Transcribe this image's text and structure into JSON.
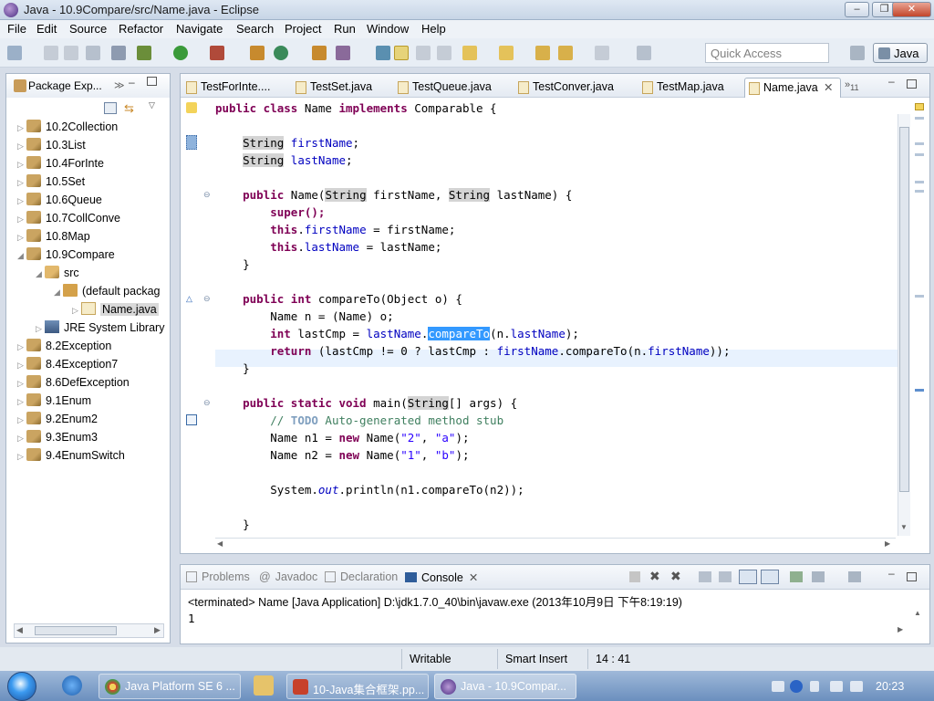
{
  "window": {
    "title": "Java - 10.9Compare/src/Name.java - Eclipse",
    "buttons": [
      "minimize",
      "maximize",
      "close"
    ]
  },
  "menu": [
    "File",
    "Edit",
    "Source",
    "Refactor",
    "Navigate",
    "Search",
    "Project",
    "Run",
    "Window",
    "Help"
  ],
  "toolbar": {
    "quick_access_placeholder": "Quick Access",
    "perspective": "Java"
  },
  "package_explorer": {
    "title": "Package Exp...",
    "tree": [
      {
        "label": "10.2Collection",
        "type": "project",
        "expanded": false
      },
      {
        "label": "10.3List",
        "type": "project",
        "expanded": false
      },
      {
        "label": "10.4ForInte",
        "type": "project",
        "expanded": false
      },
      {
        "label": "10.5Set",
        "type": "project",
        "expanded": false
      },
      {
        "label": "10.6Queue",
        "type": "project",
        "expanded": false
      },
      {
        "label": "10.7CollConve",
        "type": "project",
        "expanded": false
      },
      {
        "label": "10.8Map",
        "type": "project",
        "expanded": false
      },
      {
        "label": "10.9Compare",
        "type": "project",
        "expanded": true
      },
      {
        "label": "src",
        "type": "source-folder",
        "expanded": true
      },
      {
        "label": "(default packag",
        "type": "package",
        "expanded": true
      },
      {
        "label": "Name.java",
        "type": "java-file",
        "selected": true
      },
      {
        "label": "JRE System Library",
        "type": "library",
        "expanded": false
      },
      {
        "label": "8.2Exception",
        "type": "project",
        "expanded": false
      },
      {
        "label": "8.4Exception7",
        "type": "project",
        "expanded": false
      },
      {
        "label": "8.6DefException",
        "type": "project",
        "expanded": false
      },
      {
        "label": "9.1Enum",
        "type": "project",
        "expanded": false
      },
      {
        "label": "9.2Enum2",
        "type": "project",
        "expanded": false
      },
      {
        "label": "9.3Enum3",
        "type": "project",
        "expanded": false
      },
      {
        "label": "9.4EnumSwitch",
        "type": "project",
        "expanded": false
      }
    ]
  },
  "editor": {
    "tabs": [
      {
        "label": "TestForInte....",
        "active": false
      },
      {
        "label": "TestSet.java",
        "active": false
      },
      {
        "label": "TestQueue.java",
        "active": false
      },
      {
        "label": "TestConver.java",
        "active": false
      },
      {
        "label": "TestMap.java",
        "active": false
      },
      {
        "label": "Name.java",
        "active": true
      }
    ],
    "overflow_count": "11",
    "code": {
      "l1": "public class Name implements Comparable {",
      "l3_type": "String",
      "l3_field": "firstName",
      "l4_type": "String",
      "l4_field": "lastName",
      "l6_kw": "public",
      "l6_name": "Name(",
      "l6_t1": "String",
      "l6_p1": " firstName, ",
      "l6_t2": "String",
      "l6_p2": " lastName) {",
      "l7": "super();",
      "l8_kw": "this",
      "l8_field": "firstName",
      "l8_rest": " = firstName;",
      "l9_kw": "this",
      "l9_field": "lastName",
      "l9_rest": " = lastName;",
      "l10": "}",
      "l12_kw": "public int",
      "l12_rest": " compareTo(Object o) {",
      "l13": "Name n = (Name) o;",
      "l14_kw": "int",
      "l14_a": " lastCmp = ",
      "l14_field": "lastName",
      "l14_dot": ".",
      "l14_sel": "compareTo",
      "l14_b": "(n.",
      "l14_field2": "lastName",
      "l14_c": ");",
      "l15_kw": "return",
      "l15_a": " (lastCmp != 0 ? lastCmp : ",
      "l15_field": "firstName",
      "l15_b": ".compareTo(n.",
      "l15_field2": "firstName",
      "l15_c": "));",
      "l16": "}",
      "l18_kw": "public static void",
      "l18_a": " main(",
      "l18_type": "String",
      "l18_b": "[] args) {",
      "l19_a": "// ",
      "l19_todo": "TODO",
      "l19_b": " Auto-generated method stub",
      "l20_a": "Name n1 = ",
      "l20_kw": "new",
      "l20_b": " Name(",
      "l20_s1": "\"2\"",
      "l20_c": ", ",
      "l20_s2": "\"a\"",
      "l20_d": ");",
      "l21_a": "Name n2 = ",
      "l21_kw": "new",
      "l21_b": " Name(",
      "l21_s1": "\"1\"",
      "l21_c": ", ",
      "l21_s2": "\"b\"",
      "l21_d": ");",
      "l23_a": "System.",
      "l23_out": "out",
      "l23_b": ".println(n1.compareTo(n2));",
      "l25": "}"
    }
  },
  "console": {
    "tabs": [
      "Problems",
      "Javadoc",
      "Declaration",
      "Console"
    ],
    "active_tab": "Console",
    "status": "<terminated> Name [Java Application] D:\\jdk1.7.0_40\\bin\\javaw.exe (2013年10月9日 下午8:19:19)",
    "output": "1"
  },
  "statusbar": {
    "writable": "Writable",
    "insert_mode": "Smart Insert",
    "position": "14 : 41"
  },
  "taskbar": {
    "tasks": [
      {
        "label": "Java Platform SE 6 ...",
        "active": false
      },
      {
        "label": "10-Java集合框架.pp...",
        "active": false
      },
      {
        "label": "Java - 10.9Compar...",
        "active": true
      }
    ],
    "clock": "20:23"
  },
  "colors": {
    "keyword": "#7f0055",
    "field": "#0000c0",
    "comment": "#3f7f5f",
    "string": "#2a00ff",
    "selection": "#3399ff",
    "current_line": "#e8f2fe"
  }
}
